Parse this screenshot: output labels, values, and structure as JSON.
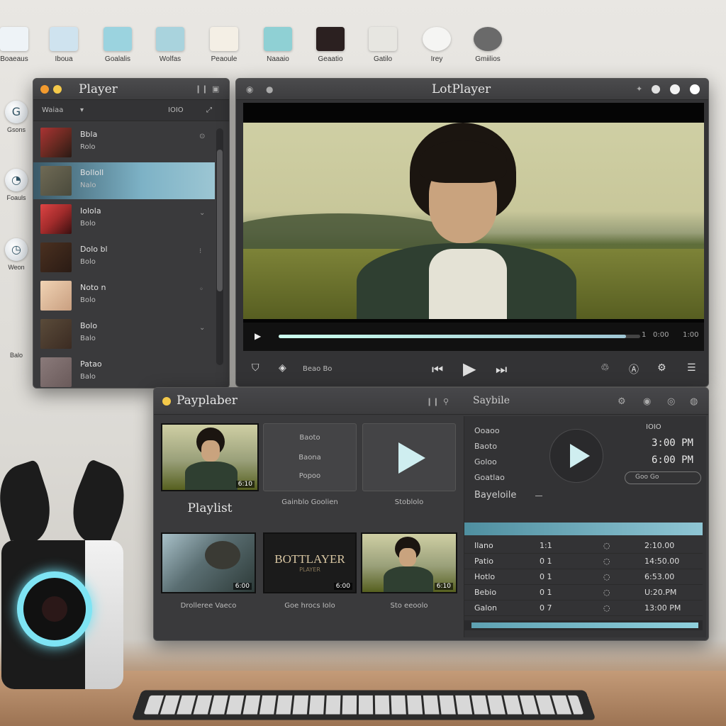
{
  "desktop": {
    "top_icons": [
      {
        "label": "Boaeaus",
        "color": "#eef3f7"
      },
      {
        "label": "Iboua",
        "color": "#cfe3ef"
      },
      {
        "label": "Goalalis",
        "color": "#9bd3df"
      },
      {
        "label": "Wolfas",
        "color": "#a9d3dd"
      },
      {
        "label": "Peaoule",
        "color": "#f4efe5"
      },
      {
        "label": "Naaaio",
        "color": "#8fd0d4"
      },
      {
        "label": "Geaatio",
        "color": "#2b2020"
      },
      {
        "label": "Gatilo",
        "color": "#e7e6e1"
      },
      {
        "label": "Irey",
        "color": "#f5f5f3"
      },
      {
        "label": "Gmiilios",
        "color": "#6a6a6a"
      }
    ],
    "left_icons": [
      {
        "label": "Gsons",
        "glyph": "G"
      },
      {
        "label": "Foauls",
        "glyph": "◔"
      },
      {
        "label": "Weon",
        "glyph": "◷"
      },
      {
        "label": "Balo",
        "glyph": ""
      }
    ]
  },
  "playlist_window": {
    "title": "Player",
    "header_left": "Waiaa",
    "header_right": "IOIO",
    "items": [
      {
        "title": "Bbla",
        "sub": "Rolo",
        "color": "#6b2a22"
      },
      {
        "title": "Bolloll",
        "sub": "Nalo",
        "color": "#4a4a3c"
      },
      {
        "title": "Iolola",
        "sub": "Bolo",
        "color": "#a12b2b"
      },
      {
        "title": "Dolo bl",
        "sub": "Bolo",
        "color": "#2a1b14"
      },
      {
        "title": "Noto n",
        "sub": "Bolo",
        "color": "#e6c3a3"
      },
      {
        "title": "Bolo",
        "sub": "Balo",
        "color": "#3b2b22"
      },
      {
        "title": "Patao",
        "sub": "Balo",
        "color": "#6a5a5a"
      }
    ]
  },
  "main_window": {
    "title": "LotPlayer",
    "time_left": "1",
    "time_mid": "0:00",
    "time_right": "1:00",
    "progress": 0.96,
    "toolbar_text": "Beao  Bo",
    "icons": [
      "shield-icon",
      "info-icon",
      "prev-icon",
      "play-icon",
      "next-icon",
      "fx-icon",
      "a-icon",
      "settings-icon",
      "list-icon"
    ]
  },
  "bottom_window": {
    "title": "Payplaber",
    "right_title": "Saybile",
    "cards": [
      {
        "caption": "Playlist",
        "badge": "6:10"
      },
      {
        "caption": "Gainblo  Goolien",
        "lines": [
          "Baoto",
          "Baona",
          "Popoo"
        ]
      },
      {
        "caption": "Stoblolo"
      },
      {
        "caption": "Drolleree  Vaeco",
        "badge": "6:00"
      },
      {
        "caption": "Goe hrocs  Iolo",
        "badge": "6:00",
        "banner": "BOTTLAYER",
        "banner_sub": "PLAYER"
      },
      {
        "caption": "Sto eeoolo",
        "badge": "6:10"
      }
    ],
    "panel": {
      "labels": [
        "Ooaoo",
        "Baoto",
        "Goloo",
        "Goatlao",
        "Bayeloile"
      ],
      "tag": "IOIO",
      "time1": "3:00 PM",
      "time2": "6:00 PM",
      "chip": "Goo  Go",
      "table": [
        {
          "a": "Ilano",
          "b": "1:1",
          "c": "2:10.00"
        },
        {
          "a": "Patio",
          "b": "0 1",
          "c": "14:50.00"
        },
        {
          "a": "Hotlo",
          "b": "0 1",
          "c": "6:53.00"
        },
        {
          "a": "Bebio",
          "b": "0 1",
          "c": "U:20.PM"
        },
        {
          "a": "Galon",
          "b": "0 7",
          "c": "13:00 PM"
        }
      ]
    }
  }
}
